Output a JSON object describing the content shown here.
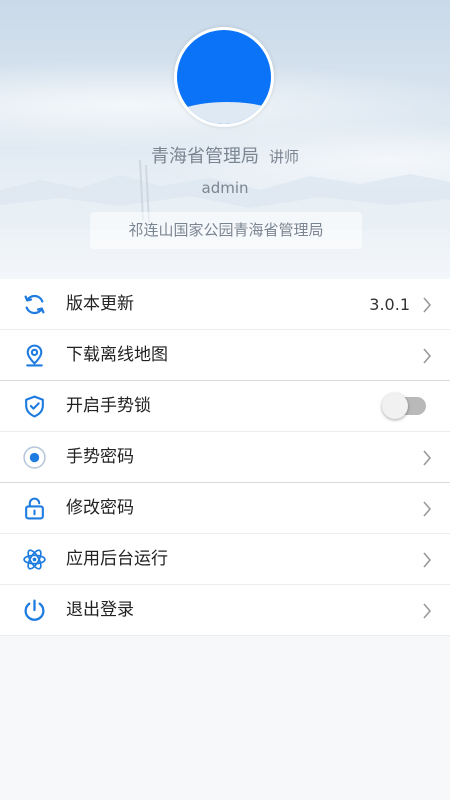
{
  "profile": {
    "org": "青海省管理局",
    "role": "讲师",
    "username": "admin",
    "unit": "祁连山国家公园青海省管理局",
    "avatar_color": "#0a73f7"
  },
  "menu": {
    "version_update": {
      "label": "版本更新",
      "value": "3.0.1",
      "icon": "refresh-icon"
    },
    "offline_map": {
      "label": "下载离线地图",
      "icon": "location-pin-icon"
    },
    "gesture_lock": {
      "label": "开启手势锁",
      "icon": "shield-check-icon",
      "enabled": false
    },
    "gesture_password": {
      "label": "手势密码",
      "icon": "radio-dot-icon"
    },
    "change_password": {
      "label": "修改密码",
      "icon": "lock-icon"
    },
    "background_run": {
      "label": "应用后台运行",
      "icon": "atom-icon"
    },
    "logout": {
      "label": "退出登录",
      "icon": "power-icon"
    }
  },
  "colors": {
    "accent": "#1e7be0",
    "text": "#222222",
    "muted": "#7b8591"
  }
}
